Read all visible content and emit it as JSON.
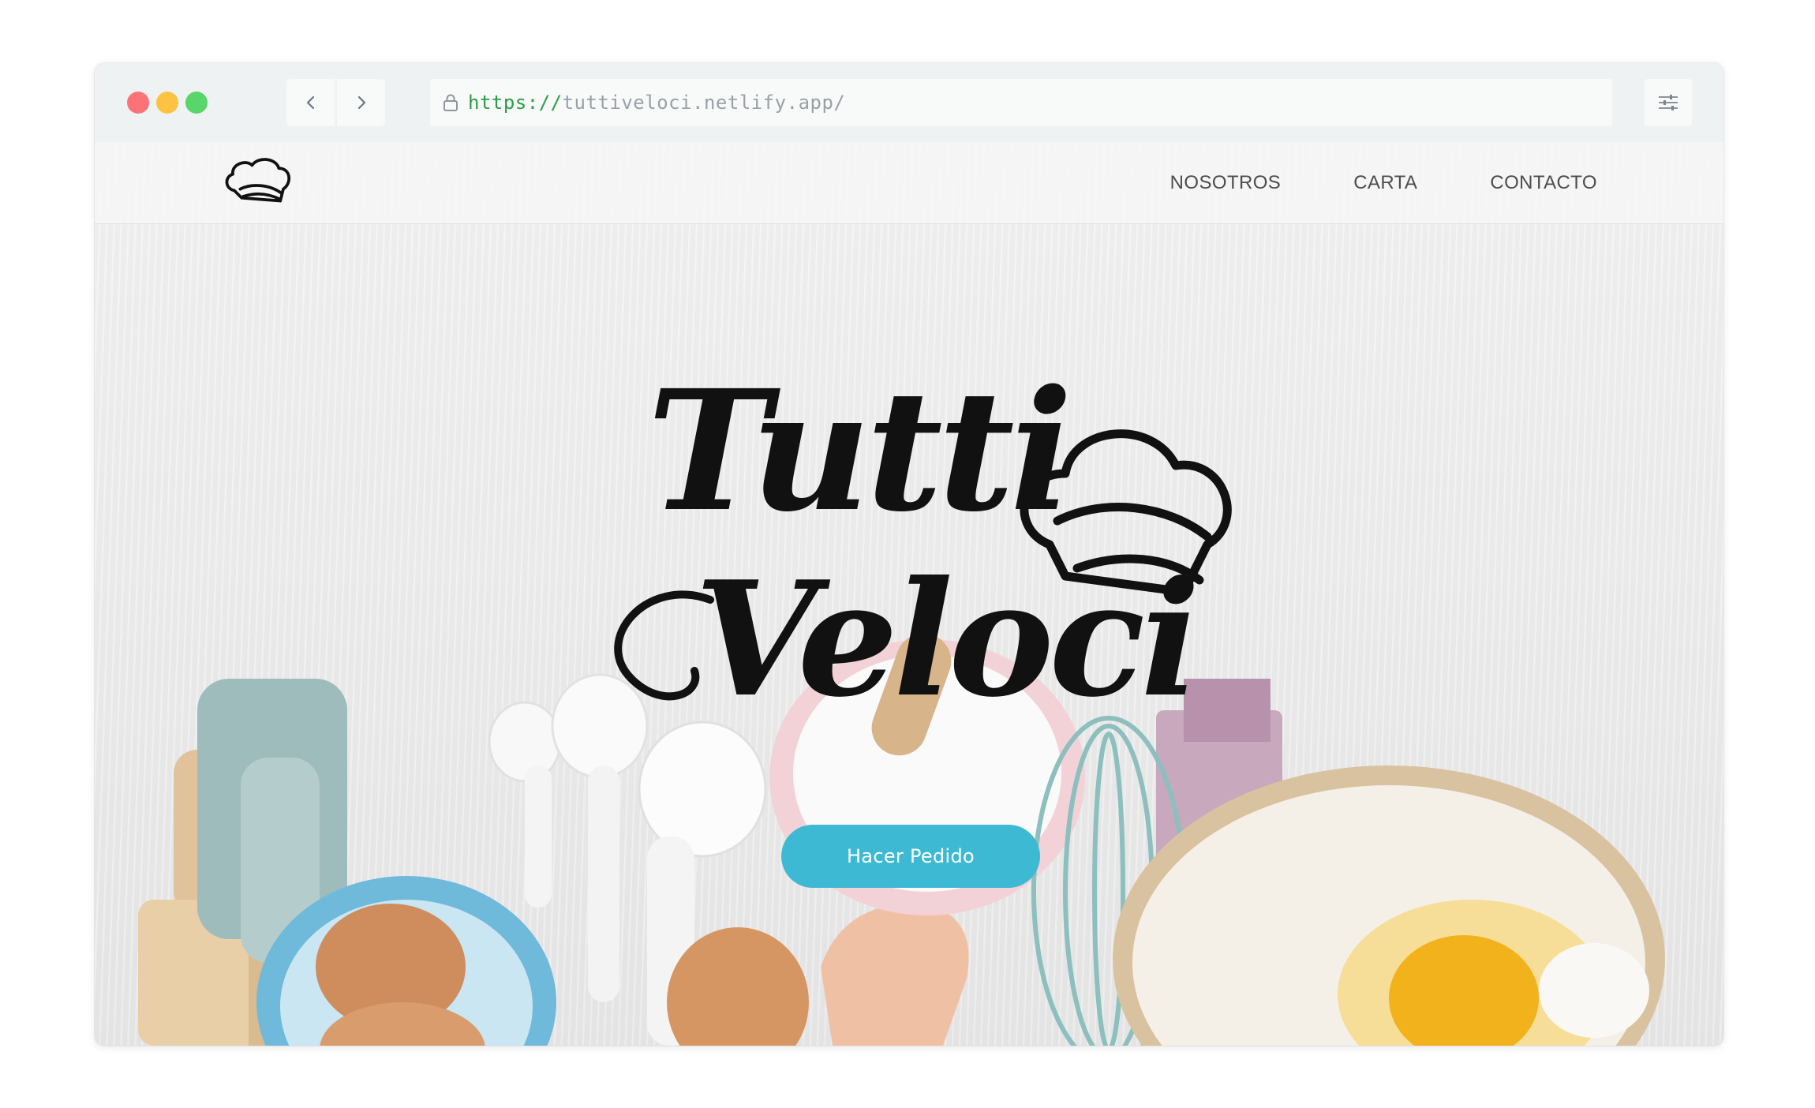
{
  "browser": {
    "url_scheme": "https://",
    "url_host": "tuttiveloci.netlify.app/",
    "window_dots": [
      "#fb7376",
      "#fbc341",
      "#58d669"
    ]
  },
  "icons": {
    "back": "chevron-left-icon",
    "forward": "chevron-right-icon",
    "lock": "lock-icon",
    "menu": "sliders-icon",
    "logo": "chef-hat-icon"
  },
  "site": {
    "nav": [
      {
        "label": "NOSOTROS"
      },
      {
        "label": "CARTA"
      },
      {
        "label": "CONTACTO"
      }
    ],
    "brand_line1": "Tutti",
    "brand_line2": "Veloci",
    "cta_label": "Hacer Pedido",
    "accent_color": "#3db9d3"
  }
}
